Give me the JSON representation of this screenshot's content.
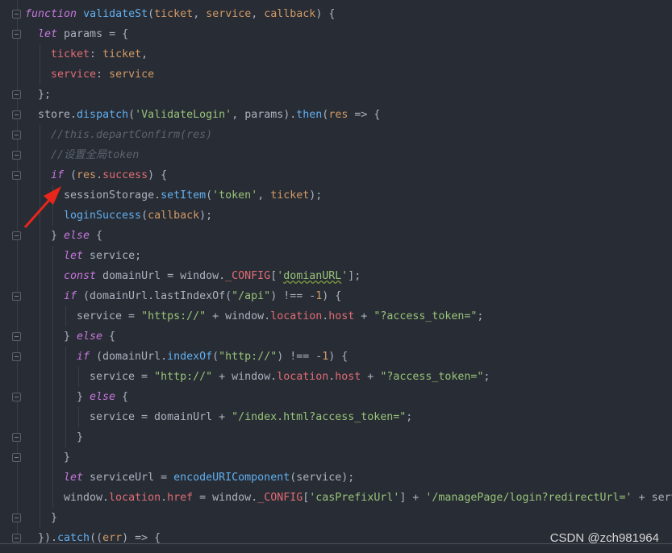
{
  "editor": {
    "lines": [
      {
        "indent": 0,
        "tokens": [
          [
            "function",
            "kw"
          ],
          [
            " ",
            ""
          ],
          [
            "validateSt",
            "fn"
          ],
          [
            "(",
            ""
          ],
          [
            "ticket",
            "param"
          ],
          [
            ", ",
            ""
          ],
          [
            "service",
            "param"
          ],
          [
            ", ",
            ""
          ],
          [
            "callback",
            "param"
          ],
          [
            ") {",
            ""
          ]
        ]
      },
      {
        "indent": 2,
        "tokens": [
          [
            "let",
            "kw"
          ],
          [
            " params = {",
            ""
          ]
        ]
      },
      {
        "indent": 4,
        "tokens": [
          [
            "ticket",
            "prop"
          ],
          [
            ": ",
            ""
          ],
          [
            "ticket",
            "param"
          ],
          [
            ",",
            ""
          ]
        ]
      },
      {
        "indent": 4,
        "tokens": [
          [
            "service",
            "prop"
          ],
          [
            ": ",
            ""
          ],
          [
            "service",
            "param"
          ]
        ]
      },
      {
        "indent": 2,
        "tokens": [
          [
            "};",
            ""
          ]
        ]
      },
      {
        "indent": 2,
        "tokens": [
          [
            "store.",
            ""
          ],
          [
            "dispatch",
            "fn"
          ],
          [
            "(",
            ""
          ],
          [
            "'ValidateLogin'",
            "str"
          ],
          [
            ", params).",
            ""
          ],
          [
            "then",
            "fn"
          ],
          [
            "(",
            ""
          ],
          [
            "res",
            "param"
          ],
          [
            " => {",
            ""
          ]
        ]
      },
      {
        "indent": 4,
        "tokens": [
          [
            "//this.departConfirm(res)",
            "com"
          ]
        ]
      },
      {
        "indent": 4,
        "tokens": [
          [
            "//设置全局token",
            "com"
          ]
        ]
      },
      {
        "indent": 4,
        "tokens": [
          [
            "if",
            "kw"
          ],
          [
            " (",
            ""
          ],
          [
            "res",
            "param"
          ],
          [
            ".",
            ""
          ],
          [
            "success",
            "prop"
          ],
          [
            ") {",
            ""
          ]
        ]
      },
      {
        "indent": 6,
        "tokens": [
          [
            "sessionStorage.",
            ""
          ],
          [
            "setItem",
            "fn"
          ],
          [
            "(",
            ""
          ],
          [
            "'token'",
            "str"
          ],
          [
            ", ",
            ""
          ],
          [
            "ticket",
            "param"
          ],
          [
            ");",
            ""
          ]
        ]
      },
      {
        "indent": 6,
        "tokens": [
          [
            "loginSuccess",
            "fn"
          ],
          [
            "(",
            ""
          ],
          [
            "callback",
            "param"
          ],
          [
            ");",
            ""
          ]
        ]
      },
      {
        "indent": 4,
        "tokens": [
          [
            "} ",
            ""
          ],
          [
            "else",
            "kw"
          ],
          [
            " {",
            ""
          ]
        ]
      },
      {
        "indent": 6,
        "tokens": [
          [
            "let",
            "kw"
          ],
          [
            " service;",
            ""
          ]
        ]
      },
      {
        "indent": 6,
        "tokens": [
          [
            "const",
            "kw"
          ],
          [
            " domainUrl = window.",
            ""
          ],
          [
            "_CONFIG",
            "prop"
          ],
          [
            "[",
            ""
          ],
          [
            "'",
            "str"
          ],
          [
            "domianURL",
            "warn"
          ],
          [
            "'",
            "str"
          ],
          [
            "];",
            ""
          ]
        ]
      },
      {
        "indent": 6,
        "tokens": [
          [
            "if",
            "kw"
          ],
          [
            " (domainUrl.lastIndexOf(",
            ""
          ],
          [
            "\"/api\"",
            "str"
          ],
          [
            ") !== -",
            ""
          ],
          [
            "1",
            "num"
          ],
          [
            ") {",
            ""
          ]
        ]
      },
      {
        "indent": 8,
        "tokens": [
          [
            "service = ",
            ""
          ],
          [
            "\"https://\"",
            "str"
          ],
          [
            " + window.",
            ""
          ],
          [
            "location",
            "prop"
          ],
          [
            ".",
            ""
          ],
          [
            "host",
            "prop"
          ],
          [
            " + ",
            ""
          ],
          [
            "\"?access_token=\"",
            "str"
          ],
          [
            ";",
            ""
          ]
        ]
      },
      {
        "indent": 6,
        "tokens": [
          [
            "} ",
            ""
          ],
          [
            "else",
            "kw"
          ],
          [
            " {",
            ""
          ]
        ]
      },
      {
        "indent": 8,
        "tokens": [
          [
            "if",
            "kw"
          ],
          [
            " (domainUrl.",
            ""
          ],
          [
            "indexOf",
            "fn"
          ],
          [
            "(",
            ""
          ],
          [
            "\"http://\"",
            "str"
          ],
          [
            ") !== -",
            ""
          ],
          [
            "1",
            "num"
          ],
          [
            ") {",
            ""
          ]
        ]
      },
      {
        "indent": 10,
        "tokens": [
          [
            "service = ",
            ""
          ],
          [
            "\"http://\"",
            "str"
          ],
          [
            " + window.",
            ""
          ],
          [
            "location",
            "prop"
          ],
          [
            ".",
            ""
          ],
          [
            "host",
            "prop"
          ],
          [
            " + ",
            ""
          ],
          [
            "\"?access_token=\"",
            "str"
          ],
          [
            ";",
            ""
          ]
        ]
      },
      {
        "indent": 8,
        "tokens": [
          [
            "} ",
            ""
          ],
          [
            "else",
            "kw"
          ],
          [
            " {",
            ""
          ]
        ]
      },
      {
        "indent": 10,
        "tokens": [
          [
            "service = domainUrl + ",
            ""
          ],
          [
            "\"/index.html?access_token=\"",
            "str"
          ],
          [
            ";",
            ""
          ]
        ]
      },
      {
        "indent": 8,
        "tokens": [
          [
            "}",
            ""
          ]
        ]
      },
      {
        "indent": 6,
        "tokens": [
          [
            "}",
            ""
          ]
        ]
      },
      {
        "indent": 6,
        "tokens": [
          [
            "let",
            "kw"
          ],
          [
            " serviceUrl = ",
            ""
          ],
          [
            "encodeURIComponent",
            "fn"
          ],
          [
            "(service);",
            ""
          ]
        ]
      },
      {
        "indent": 6,
        "tokens": [
          [
            "window.",
            ""
          ],
          [
            "location",
            "prop"
          ],
          [
            ".",
            ""
          ],
          [
            "href",
            "prop"
          ],
          [
            " = window.",
            ""
          ],
          [
            "_CONFIG",
            "prop"
          ],
          [
            "[",
            ""
          ],
          [
            "'casPrefixUrl'",
            "str"
          ],
          [
            "] + ",
            ""
          ],
          [
            "'/managePage/login?redirectUrl='",
            "str"
          ],
          [
            " + serv",
            ""
          ]
        ]
      },
      {
        "indent": 4,
        "tokens": [
          [
            "}",
            ""
          ]
        ]
      },
      {
        "indent": 2,
        "tokens": [
          [
            "}).",
            ""
          ],
          [
            "catch",
            "fn"
          ],
          [
            "((",
            ""
          ],
          [
            "err",
            "param"
          ],
          [
            ") => {",
            ""
          ]
        ]
      }
    ],
    "fold_lines": [
      0,
      1,
      4,
      5,
      6,
      7,
      8,
      11,
      14,
      16,
      17,
      19,
      21,
      22,
      25,
      26
    ]
  },
  "watermark": "CSDN @zch981964",
  "colors": {
    "background": "#282c34",
    "keyword": "#c678dd",
    "function": "#61afef",
    "parameter": "#d19a66",
    "property": "#e06c75",
    "string": "#98c379",
    "comment": "#5c6370",
    "text": "#abb2bf",
    "arrow": "#e8261c"
  }
}
